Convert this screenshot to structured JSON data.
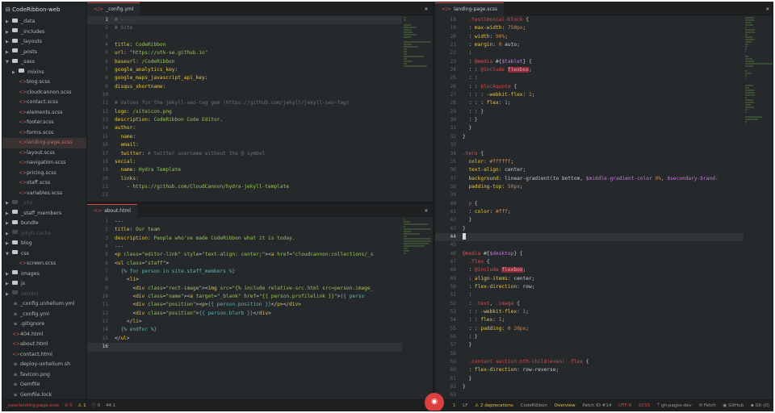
{
  "sidebar": {
    "root": "CodeRibbon-web",
    "items": [
      {
        "label": "_data",
        "type": "folder",
        "indent": 0,
        "arrow": "▶"
      },
      {
        "label": "_includes",
        "type": "folder",
        "indent": 0,
        "arrow": "▶"
      },
      {
        "label": "_layouts",
        "type": "folder",
        "indent": 0,
        "arrow": "▶"
      },
      {
        "label": "_posts",
        "type": "folder",
        "indent": 0,
        "arrow": "▶"
      },
      {
        "label": "_sass",
        "type": "folder",
        "indent": 0,
        "arrow": "▼"
      },
      {
        "label": "mixins",
        "type": "folder",
        "indent": 1,
        "arrow": "▶"
      },
      {
        "label": "blog.scss",
        "type": "file",
        "indent": 2
      },
      {
        "label": "cloudcannon.scss",
        "type": "file",
        "indent": 2
      },
      {
        "label": "contact.scss",
        "type": "file",
        "indent": 2
      },
      {
        "label": "elements.scss",
        "type": "file",
        "indent": 2
      },
      {
        "label": "footer.scss",
        "type": "file",
        "indent": 2
      },
      {
        "label": "forms.scss",
        "type": "file",
        "indent": 2
      },
      {
        "label": "landing-page.scss",
        "type": "file",
        "indent": 2,
        "selected": true
      },
      {
        "label": "layout.scss",
        "type": "file",
        "indent": 2
      },
      {
        "label": "navigation.scss",
        "type": "file",
        "indent": 2
      },
      {
        "label": "pricing.scss",
        "type": "file",
        "indent": 2
      },
      {
        "label": "staff.scss",
        "type": "file",
        "indent": 2
      },
      {
        "label": "variables.scss",
        "type": "file",
        "indent": 2
      },
      {
        "label": "_site",
        "type": "folder",
        "indent": 0,
        "arrow": "▶",
        "dim": true
      },
      {
        "label": "_staff_members",
        "type": "folder",
        "indent": 0,
        "arrow": "▶"
      },
      {
        "label": "bundle",
        "type": "folder",
        "indent": 0,
        "arrow": "▶"
      },
      {
        "label": "jekyll-cache",
        "type": "folder",
        "indent": 0,
        "arrow": "▶",
        "dim": true
      },
      {
        "label": "blog",
        "type": "folder",
        "indent": 0,
        "arrow": "▶"
      },
      {
        "label": "css",
        "type": "folder",
        "indent": 0,
        "arrow": "▼"
      },
      {
        "label": "screen.scss",
        "type": "file",
        "indent": 2
      },
      {
        "label": "images",
        "type": "folder",
        "indent": 0,
        "arrow": "▶"
      },
      {
        "label": "js",
        "type": "folder",
        "indent": 0,
        "arrow": "▶"
      },
      {
        "label": "vendor",
        "type": "folder",
        "indent": 0,
        "arrow": "▶",
        "dim": true
      },
      {
        "label": "_config.unhelium.yml",
        "type": "file",
        "indent": 1,
        "grey": true
      },
      {
        "label": "_config.yml",
        "type": "file",
        "indent": 1,
        "grey": true
      },
      {
        "label": ".gitignore",
        "type": "file",
        "indent": 1,
        "grey": true
      },
      {
        "label": "404.html",
        "type": "file",
        "indent": 1
      },
      {
        "label": "about.html",
        "type": "file",
        "indent": 1
      },
      {
        "label": "contact.html",
        "type": "file",
        "indent": 1
      },
      {
        "label": "deploy-unhelium.sh",
        "type": "file",
        "indent": 1,
        "grey": true
      },
      {
        "label": "favicon.png",
        "type": "file",
        "indent": 1,
        "grey": true
      },
      {
        "label": "Gemfile",
        "type": "file",
        "indent": 1,
        "grey": true
      },
      {
        "label": "Gemfile.lock",
        "type": "file",
        "indent": 1,
        "grey": true
      },
      {
        "label": "index.html",
        "type": "file",
        "indent": 1
      }
    ]
  },
  "panes": {
    "config": {
      "tab": "_config.yml",
      "lines": [
        {
          "n": "1",
          "html": "<span class='c-com'># ----</span>",
          "active": true
        },
        {
          "n": "2",
          "html": "<span class='c-com'># Site</span>"
        },
        {
          "n": "3",
          "html": ""
        },
        {
          "n": "4",
          "html": "<span class='c-key'>title</span>: <span class='c-str'>CodeRibbon</span>"
        },
        {
          "n": "5",
          "html": "<span class='c-key'>url</span>: <span class='c-str'>\"https://utk-se.github.io\"</span>"
        },
        {
          "n": "6",
          "html": "<span class='c-key'>baseurl</span>: <span class='c-str'>/CodeRibbon</span>"
        },
        {
          "n": "7",
          "html": "<span class='c-key'>google_analytics_key</span>:"
        },
        {
          "n": "8",
          "html": "<span class='c-key'>google_maps_javascript_api_key</span>:"
        },
        {
          "n": "9",
          "html": "<span class='c-key'>disqus_shortname</span>:"
        },
        {
          "n": "10",
          "html": ""
        },
        {
          "n": "11",
          "html": "<span class='c-com'># Values for the jekyll-seo-tag gem (https://github.com/jekyll/jekyll-seo-tag)</span>"
        },
        {
          "n": "12",
          "html": "<span class='c-key'>logo</span>: <span class='c-str'>/siteicon.png</span>"
        },
        {
          "n": "13",
          "html": "<span class='c-key'>description</span>: <span class='c-str'>CodeRibbon Code Editor.</span>"
        },
        {
          "n": "14",
          "html": "<span class='c-key'>author</span>:"
        },
        {
          "n": "15",
          "html": "  <span class='c-key'>name</span>:"
        },
        {
          "n": "16",
          "html": "  <span class='c-key'>email</span>:"
        },
        {
          "n": "17",
          "html": "  <span class='c-key'>twitter</span>: <span class='c-com'># twitter username without the @ symbol</span>"
        },
        {
          "n": "18",
          "html": "<span class='c-key'>social</span>:"
        },
        {
          "n": "19",
          "html": "  <span class='c-key'>name</span>: <span class='c-str'>Hydra Template</span>"
        },
        {
          "n": "20",
          "html": "  <span class='c-key'>links</span>:"
        },
        {
          "n": "21",
          "html": "    - <span class='c-str'>https://github.com/CloudCannon/hydra-jekyll-template</span>"
        },
        {
          "n": "22",
          "html": ""
        }
      ]
    },
    "about": {
      "tab": "about.html",
      "lines": [
        {
          "n": "1",
          "html": "---"
        },
        {
          "n": "2",
          "html": "<span class='c-key'>title</span>: <span class='c-str'>Our team</span>"
        },
        {
          "n": "3",
          "html": "<span class='c-key'>description</span>: <span class='c-str'>People who've made CodeRibbon what it is today.</span>"
        },
        {
          "n": "4",
          "html": "---"
        },
        {
          "n": "5",
          "html": "&lt;<span class='c-tag'>p</span> <span class='c-attr'>class</span>=<span class='c-str'>\"editor-link\"</span> <span class='c-attr'>style</span>=<span class='c-str'>\"text-align: center;\"</span>&gt;&lt;<span class='c-tag'>a</span> <span class='c-attr'>href</span>=<span class='c-str'>\"cloudcannon:collections/_s</span>"
        },
        {
          "n": "6",
          "html": "&lt;<span class='c-tag'>ul</span> <span class='c-attr'>class</span>=<span class='c-str'>\"staff\"</span>&gt;"
        },
        {
          "n": "7",
          "html": "  <span class='c-liq'>{% for person in site.staff_members %}</span>"
        },
        {
          "n": "8",
          "html": "    &lt;<span class='c-tag'>li</span>&gt;"
        },
        {
          "n": "9",
          "html": "      &lt;<span class='c-tag'>div</span> <span class='c-attr'>class</span>=<span class='c-str'>\"rect-image\"</span>&gt;&lt;<span class='c-tag'>img</span> <span class='c-attr'>src</span>=<span class='c-str'>\"{% include relative-src.html src=person.image_</span>"
        },
        {
          "n": "10",
          "html": "      &lt;<span class='c-tag'>div</span> <span class='c-attr'>class</span>=<span class='c-str'>\"name\"</span>&gt;&lt;<span class='c-tag'>a</span> <span class='c-attr'>target</span>=<span class='c-str'>\"_blank\"</span> <span class='c-attr'>href</span>=<span class='c-str'>\"{{ person.profilelink }}\"</span>&gt;<span class='c-liq'>{{ perso</span>"
        },
        {
          "n": "11",
          "html": "      &lt;<span class='c-tag'>div</span> <span class='c-attr'>class</span>=<span class='c-str'>\"position\"</span>&gt;&lt;<span class='c-tag'>p</span>&gt;<span class='c-liq'>{{ person.position }}</span>&lt;/<span class='c-tag'>p</span>&gt;&lt;/<span class='c-tag'>div</span>&gt;"
        },
        {
          "n": "12",
          "html": "      &lt;<span class='c-tag'>div</span> <span class='c-attr'>class</span>=<span class='c-str'>\"position\"</span>&gt;<span class='c-liq'>{{ person.blurb }}</span>&lt;/<span class='c-tag'>div</span>&gt;"
        },
        {
          "n": "13",
          "html": "    &lt;/<span class='c-tag'>li</span>&gt;"
        },
        {
          "n": "14",
          "html": "  <span class='c-liq'>{% endfor %}</span>"
        },
        {
          "n": "15",
          "html": "&lt;/<span class='c-tag'>ul</span>&gt;"
        },
        {
          "n": "16",
          "html": "",
          "active": true
        }
      ]
    },
    "landing": {
      "tab": "landing-page.scss",
      "lines": [
        {
          "n": "18",
          "html": "  <span class='c-red'>.testimonial-block</span> {"
        },
        {
          "n": "19",
          "html": "  : <span class='c-key'>max-width</span>: <span class='c-num'>750px</span>;"
        },
        {
          "n": "20",
          "html": "  : <span class='c-key'>width</span>: <span class='c-num'>90%</span>;"
        },
        {
          "n": "21",
          "html": "  : <span class='c-key'>margin</span>: <span class='c-num'>0</span> auto;"
        },
        {
          "n": "22",
          "html": "  :"
        },
        {
          "n": "23",
          "html": "  : <span class='c-red'>@media</span> #{<span class='c-var'>$tablet</span>} {"
        },
        {
          "n": "24",
          "html": "  : : <span class='c-red'>@include</span> <span class='hl-flex'>flexbox</span>;"
        },
        {
          "n": "25",
          "html": "  : :"
        },
        {
          "n": "26",
          "html": "  : : <span class='c-red'>blockquote</span> {"
        },
        {
          "n": "27",
          "html": "  : : : <span class='c-key'>-webkit-flex</span>: <span class='c-num'>1</span>;"
        },
        {
          "n": "28",
          "html": "  : : : <span class='c-key'>flex</span>: <span class='c-num'>1</span>;"
        },
        {
          "n": "29",
          "html": "  : : }"
        },
        {
          "n": "30",
          "html": "  : }"
        },
        {
          "n": "31",
          "html": "  }"
        },
        {
          "n": "32",
          "html": "}"
        },
        {
          "n": "33",
          "html": ""
        },
        {
          "n": "34",
          "html": "<span class='c-red'>.hero</span> {"
        },
        {
          "n": "35",
          "html": "  <span class='c-key'>color</span>: <span class='c-num'>#ffffff</span>;"
        },
        {
          "n": "36",
          "html": "  <span class='c-key'>text-align</span>: center;"
        },
        {
          "n": "37",
          "html": "  <span class='c-key'>background</span>: linear-gradient(to bottom, <span class='c-var'>$middle-gradient-color</span> <span class='c-num'>0%</span>, <span class='c-var'>$secondary-brand-</span>"
        },
        {
          "n": "38",
          "html": "  <span class='c-key'>padding-top</span>: <span class='c-num'>50px</span>;"
        },
        {
          "n": "39",
          "html": ""
        },
        {
          "n": "40",
          "html": "  <span class='c-red'>p</span> {"
        },
        {
          "n": "41",
          "html": "  : <span class='c-key'>color</span>: <span class='c-num'>#fff</span>;"
        },
        {
          "n": "42",
          "html": "  }"
        },
        {
          "n": "43",
          "html": "}"
        },
        {
          "n": "44",
          "html": "<span class='cursor'></span>",
          "active": true
        },
        {
          "n": "45",
          "html": ""
        },
        {
          "n": "46",
          "html": "<span class='c-red'>@media</span> #{<span class='c-var'>$desktop</span>} {"
        },
        {
          "n": "47",
          "html": "  <span class='c-red'>.flex</span> {"
        },
        {
          "n": "48",
          "html": "  : <span class='c-red'>@include</span> <span class='hl-flex'>flexbox</span>;"
        },
        {
          "n": "49",
          "html": "  : <span class='c-key'>align-items</span>: center;"
        },
        {
          "n": "50",
          "html": "  : <span class='c-key'>flex-direction</span>: row;"
        },
        {
          "n": "51",
          "html": "  :"
        },
        {
          "n": "52",
          "html": "  : <span class='c-red'>.text</span>, <span class='c-red'>.image</span> {"
        },
        {
          "n": "53",
          "html": "  : : <span class='c-key'>-webkit-flex</span>: <span class='c-num'>1</span>;"
        },
        {
          "n": "54",
          "html": "  : : <span class='c-key'>flex</span>: <span class='c-num'>1</span>;"
        },
        {
          "n": "55",
          "html": "  : : <span class='c-key'>padding</span>: <span class='c-num'>0 20px</span>;"
        },
        {
          "n": "56",
          "html": "  : }"
        },
        {
          "n": "57",
          "html": "  }"
        },
        {
          "n": "58",
          "html": ""
        },
        {
          "n": "59",
          "html": "  <span class='c-red'>.content section:nth-child(even) .flex</span> {"
        },
        {
          "n": "60",
          "html": "  : <span class='c-key'>flex-direction</span>: row-reverse;"
        },
        {
          "n": "61",
          "html": "  }"
        },
        {
          "n": "62",
          "html": "}"
        },
        {
          "n": "63",
          "html": ""
        }
      ]
    }
  },
  "statusbar": {
    "file": "_sass/landing-page.scss",
    "errors": "⊘ 0",
    "warnings": "⚠ 1",
    "infos": "ⓘ 0",
    "position": "44:1",
    "r1": "1",
    "r2": "LF",
    "deprecations": "⚠ 2 deprecations",
    "project": "CodeRibbon",
    "overview": "Overview",
    "patch": "Patch ID #14",
    "encoding": "UTF-8",
    "grammar": "SCSS",
    "branch": "ᛘ gh-pages-dev",
    "fetch": "⟲ Fetch",
    "github": "◉ GitHub",
    "git": "⬥ Git (0)",
    "fab": "◉"
  }
}
